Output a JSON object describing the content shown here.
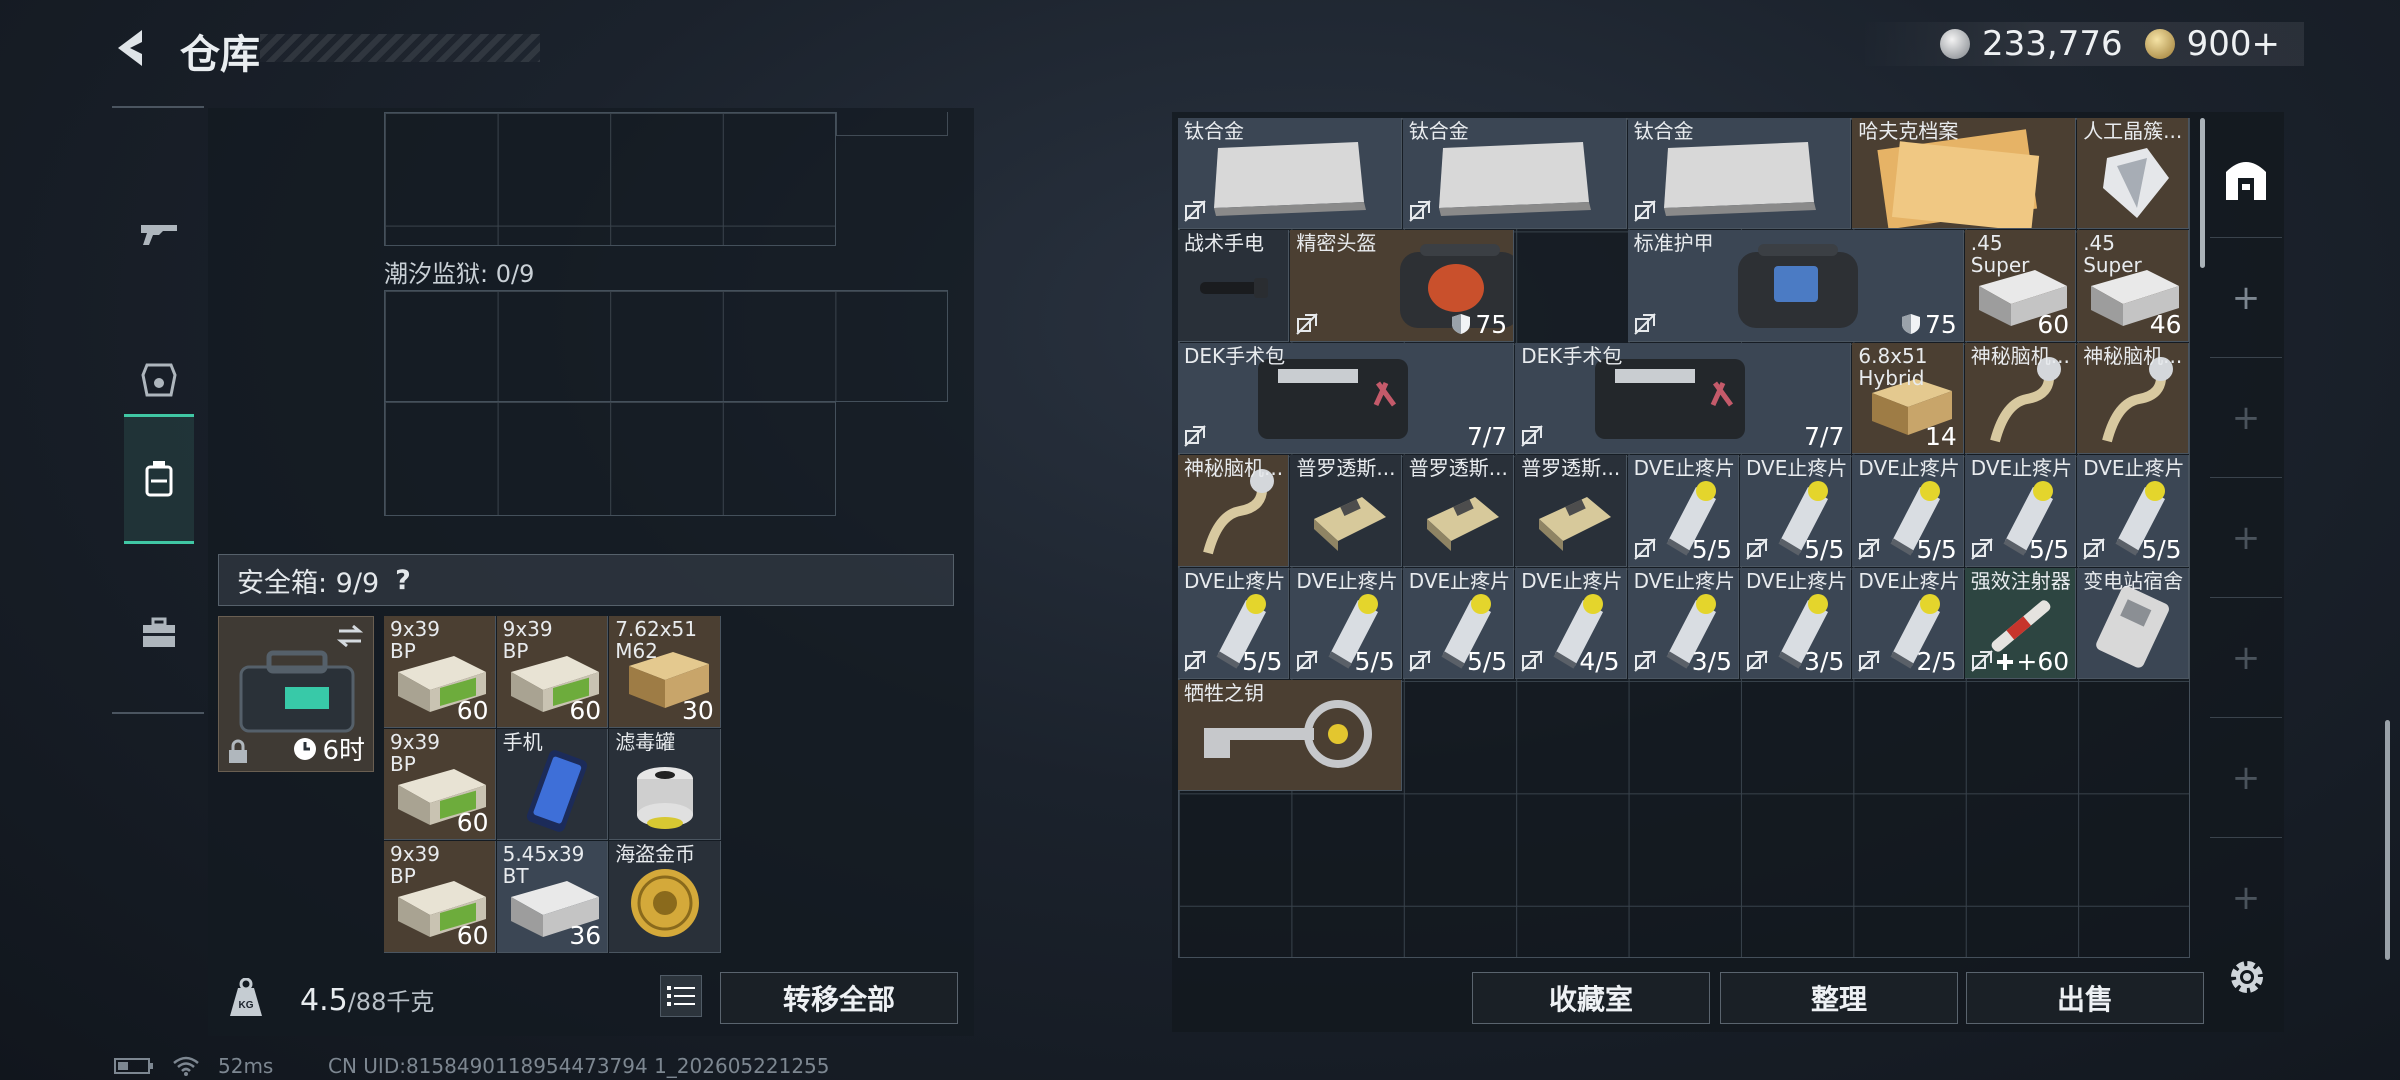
{
  "header": {
    "title": "仓库",
    "currencies": [
      {
        "icon": "silver-coin-icon",
        "value": "233,776"
      },
      {
        "icon": "gold-coin-icon",
        "value": "900+"
      }
    ]
  },
  "sidebar": {
    "items": [
      {
        "name": "weapon-tab",
        "icon": "gun-icon"
      },
      {
        "name": "armor-tab",
        "icon": "helmet-icon"
      },
      {
        "name": "backpack-tab",
        "icon": "backpack-icon",
        "active": true
      },
      {
        "name": "toolbox-tab",
        "icon": "toolbox-icon"
      }
    ]
  },
  "left": {
    "prison_label": "潮汐监狱: 0/9",
    "safe_label": "安全箱: 9/9",
    "safe_help": "?",
    "safe_timer": "6时",
    "safe_items": [
      {
        "name": "9x39\nBP",
        "qty": "60",
        "kind": "ammo-green",
        "bg": "brown"
      },
      {
        "name": "9x39\nBP",
        "qty": "60",
        "kind": "ammo-green",
        "bg": "brown"
      },
      {
        "name": "7.62x51\nM62",
        "qty": "30",
        "kind": "ammo-crate",
        "bg": "brown"
      },
      {
        "name": "9x39\nBP",
        "qty": "60",
        "kind": "ammo-green",
        "bg": "brown"
      },
      {
        "name": "手机",
        "qty": "",
        "kind": "phone",
        "bg": "dark"
      },
      {
        "name": "滤毒罐",
        "qty": "",
        "kind": "filter",
        "bg": "dark"
      },
      {
        "name": "9x39\nBP",
        "qty": "60",
        "kind": "ammo-green",
        "bg": "brown"
      },
      {
        "name": "5.45x39\nBT",
        "qty": "36",
        "kind": "ammo-white",
        "bg": "blueish"
      },
      {
        "name": "海盗金币",
        "qty": "",
        "kind": "coin",
        "bg": "dark"
      }
    ],
    "weight_value": "4.5",
    "weight_max": "/88千克",
    "transfer_all": "转移全部"
  },
  "right": {
    "items": [
      {
        "name": "钛合金",
        "qty": "",
        "kind": "plate"
      },
      {
        "name": "钛合金",
        "qty": "",
        "kind": "plate"
      },
      {
        "name": "钛合金",
        "qty": "",
        "kind": "plate"
      },
      {
        "name": "哈夫克档案",
        "qty": "",
        "kind": "docs"
      },
      {
        "name": "人工晶簇...",
        "qty": "",
        "kind": "crystal"
      },
      {
        "name": "战术手电",
        "qty": "",
        "kind": "flashlight"
      },
      {
        "name": "精密头盔",
        "qty": "75",
        "kind": "helmet-bag"
      },
      {
        "name": "标准护甲",
        "qty": "75",
        "kind": "armor-bag"
      },
      {
        "name": ".45\nSuper",
        "qty": "60",
        "kind": "ammo-white"
      },
      {
        "name": ".45\nSuper",
        "qty": "46",
        "kind": "ammo-white"
      },
      {
        "name": "DEK手术包",
        "qty": "7/7",
        "kind": "medkit"
      },
      {
        "name": "DEK手术包",
        "qty": "7/7",
        "kind": "medkit"
      },
      {
        "name": "6.8x51\nHybrid",
        "qty": "14",
        "kind": "ammo-crate"
      },
      {
        "name": "神秘脑机...",
        "qty": "",
        "kind": "cable"
      },
      {
        "name": "神秘脑机...",
        "qty": "",
        "kind": "cable"
      },
      {
        "name": "神秘脑机...",
        "qty": "",
        "kind": "cable"
      },
      {
        "name": "普罗透斯...",
        "qty": "",
        "kind": "chip"
      },
      {
        "name": "普罗透斯...",
        "qty": "",
        "kind": "chip"
      },
      {
        "name": "普罗透斯...",
        "qty": "",
        "kind": "chip"
      },
      {
        "name": "DVE止疼片",
        "qty": "5/5",
        "kind": "pill"
      },
      {
        "name": "DVE止疼片",
        "qty": "5/5",
        "kind": "pill"
      },
      {
        "name": "DVE止疼片",
        "qty": "5/5",
        "kind": "pill"
      },
      {
        "name": "DVE止疼片",
        "qty": "5/5",
        "kind": "pill"
      },
      {
        "name": "DVE止疼片",
        "qty": "5/5",
        "kind": "pill"
      },
      {
        "name": "DVE止疼片",
        "qty": "5/5",
        "kind": "pill"
      },
      {
        "name": "DVE止疼片",
        "qty": "5/5",
        "kind": "pill"
      },
      {
        "name": "DVE止疼片",
        "qty": "5/5",
        "kind": "pill"
      },
      {
        "name": "DVE止疼片",
        "qty": "4/5",
        "kind": "pill"
      },
      {
        "name": "DVE止疼片",
        "qty": "3/5",
        "kind": "pill"
      },
      {
        "name": "DVE止疼片",
        "qty": "3/5",
        "kind": "pill"
      },
      {
        "name": "DVE止疼片",
        "qty": "2/5",
        "kind": "pill"
      },
      {
        "name": "强效注射器",
        "qty": "+60",
        "kind": "injector"
      },
      {
        "name": "变电站宿舍",
        "qty": "",
        "kind": "keycard"
      },
      {
        "name": "牺牲之钥",
        "qty": "",
        "kind": "key"
      }
    ],
    "buttons": {
      "collection": "收藏室",
      "sort": "整理",
      "sell": "出售"
    }
  },
  "status": {
    "ping": "52ms",
    "uid": "CN UID:8158490118954473794 1_202605221255"
  },
  "colors": {
    "accent": "#40c7a4",
    "brown_item": "#4b3f32",
    "panel": "#141a21"
  }
}
